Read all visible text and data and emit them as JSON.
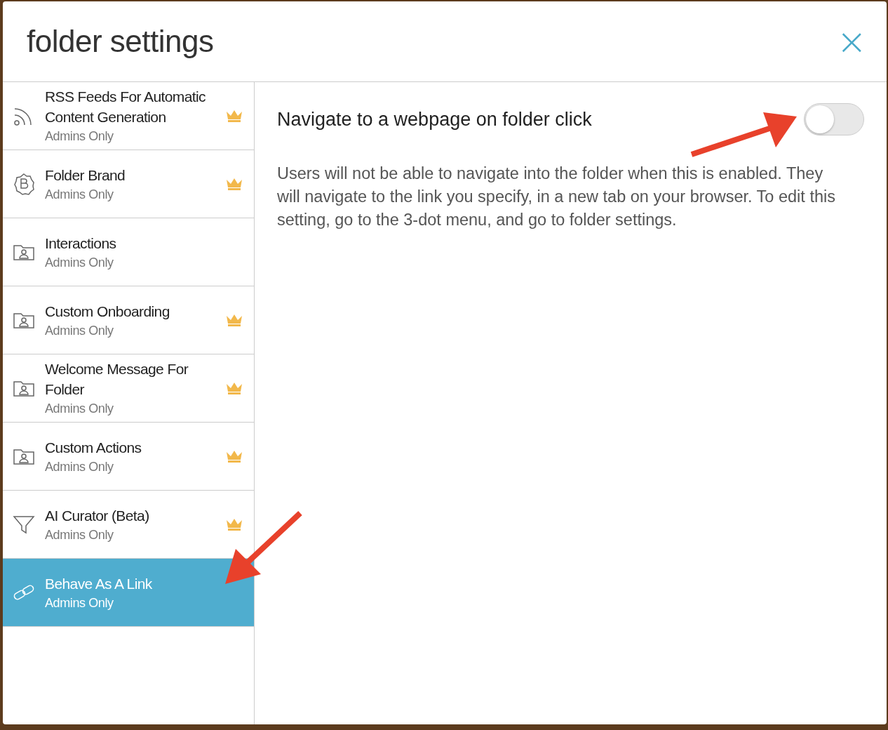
{
  "dialog": {
    "title": "folder settings",
    "close": "×"
  },
  "sidebar": {
    "items": [
      {
        "kind": "rss",
        "title": "RSS Feeds For Automatic Content Generation",
        "subtitle": "Admins Only",
        "premium": true,
        "selected": false
      },
      {
        "kind": "brand",
        "title": "Folder Brand",
        "subtitle": "Admins Only",
        "premium": true,
        "selected": false
      },
      {
        "kind": "folder-person",
        "title": "Interactions",
        "subtitle": "Admins Only",
        "premium": false,
        "selected": false
      },
      {
        "kind": "folder-person",
        "title": "Custom Onboarding",
        "subtitle": "Admins Only",
        "premium": true,
        "selected": false
      },
      {
        "kind": "folder-person",
        "title": "Welcome Message For Folder",
        "subtitle": "Admins Only",
        "premium": true,
        "selected": false
      },
      {
        "kind": "folder-person",
        "title": "Custom Actions",
        "subtitle": "Admins Only",
        "premium": true,
        "selected": false
      },
      {
        "kind": "filter",
        "title": "AI Curator (Beta)",
        "subtitle": "Admins Only",
        "premium": true,
        "selected": false
      },
      {
        "kind": "link",
        "title": "Behave As A Link",
        "subtitle": "Admins Only",
        "premium": false,
        "selected": true
      }
    ]
  },
  "setting": {
    "title": "Navigate to a webpage on folder click",
    "on": false,
    "description": "Users will not be able to navigate into the folder when this is enabled. They will navigate to the link you specify, in a new tab on your browser. To edit this setting, go to the 3-dot menu, and go to folder settings."
  }
}
